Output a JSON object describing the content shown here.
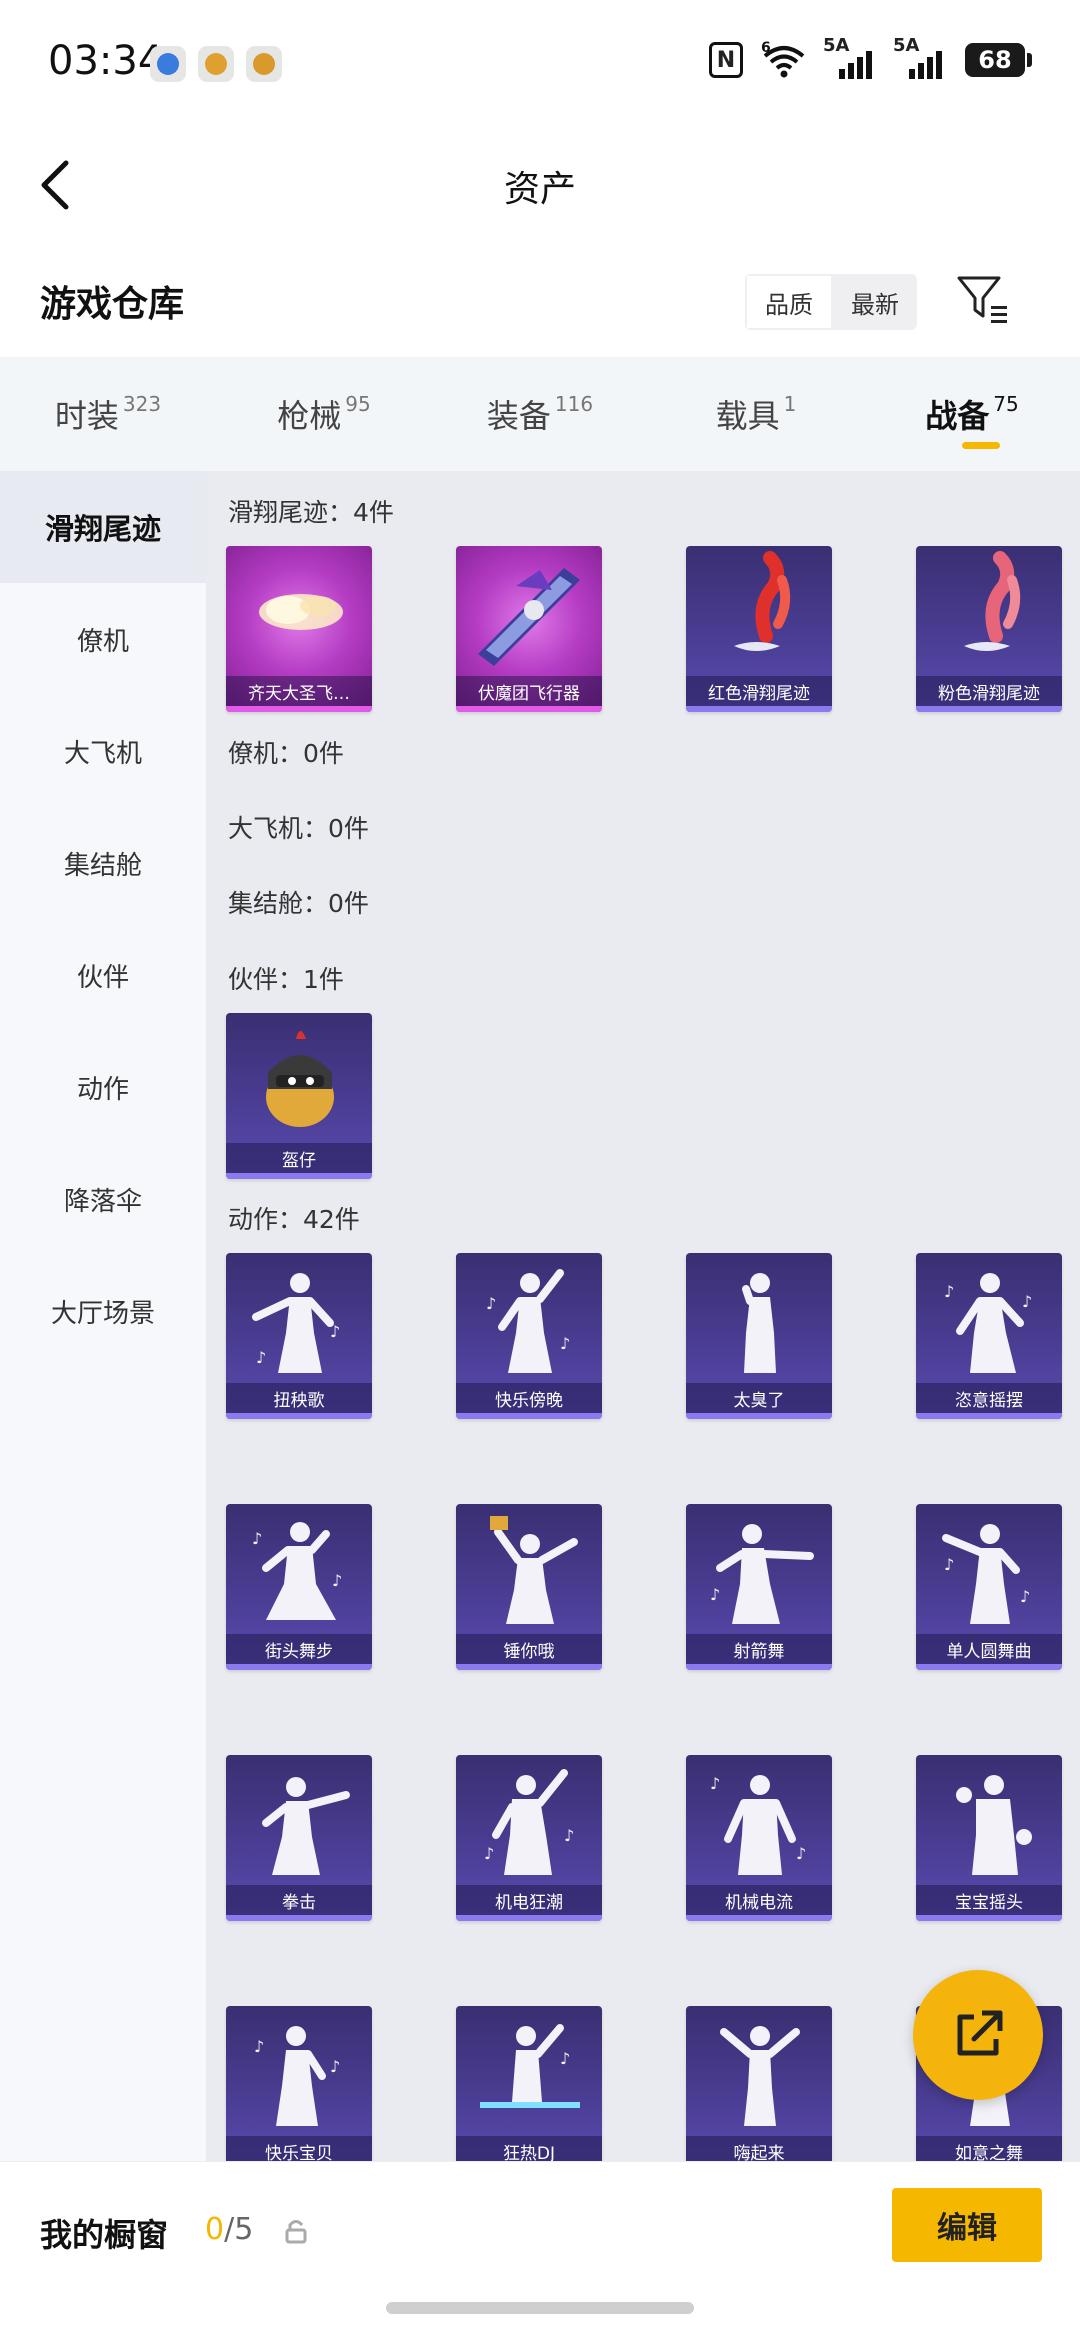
{
  "status_bar": {
    "time": "03:34",
    "signal_1_label": "5A",
    "signal_2_label": "5A",
    "wifi_label": "6",
    "battery": "68"
  },
  "header": {
    "title": "资产"
  },
  "section": {
    "title": "游戏仓库",
    "sort_options": [
      "品质",
      "最新"
    ],
    "sort_active": "品质"
  },
  "tabs": [
    {
      "label": "时装",
      "count": "323"
    },
    {
      "label": "枪械",
      "count": "95"
    },
    {
      "label": "装备",
      "count": "116"
    },
    {
      "label": "载具",
      "count": "1"
    },
    {
      "label": "战备",
      "count": "75"
    }
  ],
  "side_nav": [
    "滑翔尾迹",
    "僚机",
    "大飞机",
    "集结舱",
    "伙伴",
    "动作",
    "降落伞",
    "大厅场景"
  ],
  "content": {
    "glide_label": "滑翔尾迹：4件",
    "glide_items": [
      "齐天大圣飞…",
      "伏魔团飞行器",
      "红色滑翔尾迹",
      "粉色滑翔尾迹"
    ],
    "wingman_label": "僚机：0件",
    "plane_label": "大飞机：0件",
    "capsule_label": "集结舱：0件",
    "partner_label": "伙伴：1件",
    "partner_items": [
      "盔仔"
    ],
    "emote_label": "动作：42件",
    "emote_items": [
      "扭秧歌",
      "快乐傍晚",
      "太臭了",
      "恣意摇摆",
      "街头舞步",
      "锤你哦",
      "射箭舞",
      "单人圆舞曲",
      "拳击",
      "机电狂潮",
      "机械电流",
      "宝宝摇头",
      "快乐宝贝",
      "狂热DJ",
      "嗨起来",
      "如意之舞"
    ]
  },
  "bottom": {
    "showcase_label": "我的橱窗",
    "showcase_current": "0",
    "showcase_total": "/5",
    "edit_label": "编辑"
  },
  "colors": {
    "accent": "#f5b700",
    "card_purple": "#4a3d93",
    "card_magenta": "#b53cc4"
  }
}
